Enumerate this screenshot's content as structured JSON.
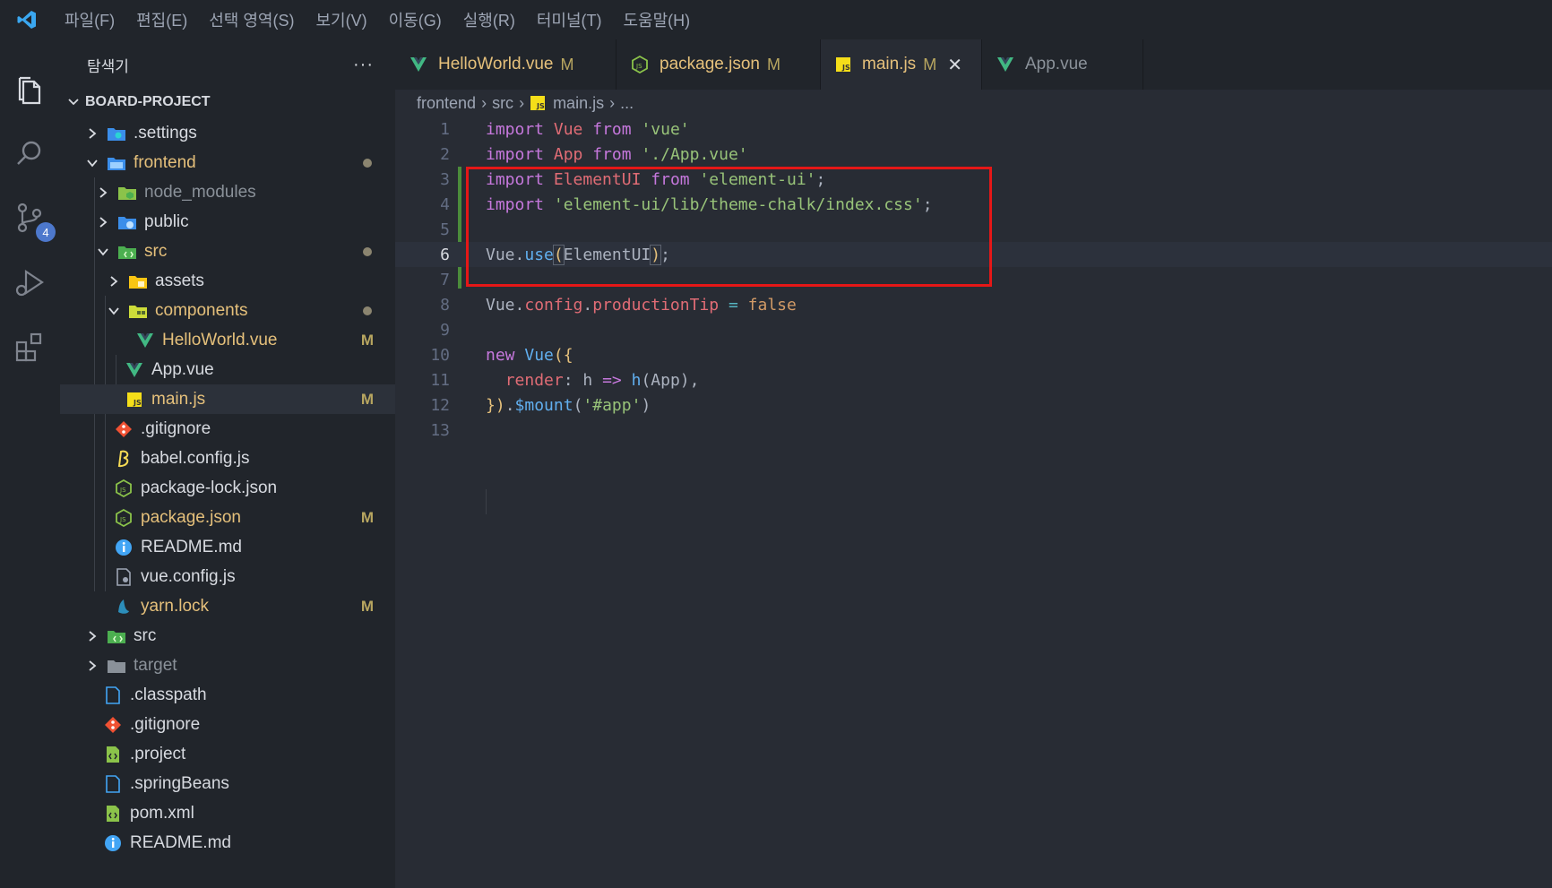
{
  "menubar": {
    "items": [
      "파일(F)",
      "편집(E)",
      "선택 영역(S)",
      "보기(V)",
      "이동(G)",
      "실행(R)",
      "터미널(T)",
      "도움말(H)"
    ]
  },
  "activitybar": {
    "icons": [
      "explorer-icon",
      "search-icon",
      "source-control-icon",
      "run-debug-icon",
      "extensions-icon"
    ],
    "source_control_badge": "4"
  },
  "sidebar": {
    "title": "탐색기",
    "more": "···",
    "project": "BOARD-PROJECT",
    "items": [
      {
        "label": ".settings",
        "icon": "settings-folder",
        "chevron": "right"
      },
      {
        "label": "frontend",
        "icon": "folder-blue",
        "chevron": "down",
        "dot": true
      },
      {
        "label": "node_modules",
        "icon": "node-folder",
        "chevron": "right"
      },
      {
        "label": "public",
        "icon": "public-folder",
        "chevron": "right"
      },
      {
        "label": "src",
        "icon": "src-folder",
        "chevron": "down",
        "dot": true
      },
      {
        "label": "assets",
        "icon": "assets-folder",
        "chevron": "right"
      },
      {
        "label": "components",
        "icon": "components-folder",
        "chevron": "down",
        "dot": true
      },
      {
        "label": "HelloWorld.vue",
        "icon": "vue",
        "mark": "M"
      },
      {
        "label": "App.vue",
        "icon": "vue"
      },
      {
        "label": "main.js",
        "icon": "js",
        "mark": "M"
      },
      {
        "label": ".gitignore",
        "icon": "git"
      },
      {
        "label": "babel.config.js",
        "icon": "babel"
      },
      {
        "label": "package-lock.json",
        "icon": "npm"
      },
      {
        "label": "package.json",
        "icon": "npm",
        "mark": "M"
      },
      {
        "label": "README.md",
        "icon": "info"
      },
      {
        "label": "vue.config.js",
        "icon": "config"
      },
      {
        "label": "yarn.lock",
        "icon": "yarn",
        "mark": "M"
      },
      {
        "label": "src",
        "icon": "src-folder",
        "chevron": "right"
      },
      {
        "label": "target",
        "icon": "folder-grey",
        "chevron": "right"
      },
      {
        "label": ".classpath",
        "icon": "file"
      },
      {
        "label": ".gitignore",
        "icon": "git"
      },
      {
        "label": ".project",
        "icon": "xml"
      },
      {
        "label": ".springBeans",
        "icon": "file"
      },
      {
        "label": "pom.xml",
        "icon": "xml"
      },
      {
        "label": "README.md",
        "icon": "info"
      }
    ]
  },
  "tabs": [
    {
      "label": "HelloWorld.vue",
      "mark": "M",
      "icon": "vue"
    },
    {
      "label": "package.json",
      "mark": "M",
      "icon": "npm"
    },
    {
      "label": "main.js",
      "mark": "M",
      "icon": "js",
      "active": true,
      "close": "✕"
    },
    {
      "label": "App.vue",
      "icon": "vue"
    }
  ],
  "breadcrumb": {
    "parts": [
      "frontend",
      "src",
      "main.js",
      "..."
    ]
  },
  "editor": {
    "line_numbers": [
      "1",
      "2",
      "3",
      "4",
      "5",
      "6",
      "7",
      "8",
      "9",
      "10",
      "11",
      "12",
      "13"
    ],
    "current_line": 6
  },
  "colors": {
    "keyword": "#c678dd",
    "variable": "#e06c75",
    "string": "#98c379",
    "function": "#61afef",
    "highlight_box": "#e51717"
  }
}
